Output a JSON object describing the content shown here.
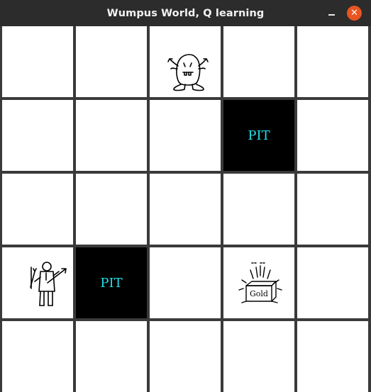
{
  "window": {
    "title": "Wumpus World, Q learning",
    "close_glyph": "✕"
  },
  "grid": {
    "rows": 5,
    "cols": 5,
    "cells": [
      [
        "empty",
        "empty",
        "wumpus",
        "empty",
        "empty"
      ],
      [
        "empty",
        "empty",
        "empty",
        "pit",
        "empty"
      ],
      [
        "empty",
        "empty",
        "empty",
        "empty",
        "empty"
      ],
      [
        "agent",
        "pit",
        "empty",
        "gold",
        "empty"
      ],
      [
        "empty",
        "empty",
        "empty",
        "empty",
        "empty"
      ]
    ]
  },
  "labels": {
    "pit": "PIT",
    "gold": "Gold"
  },
  "colors": {
    "pit_background": "#000000",
    "pit_text": "#22e0e8",
    "grid_line": "#3a3a3a",
    "cell_background": "#ffffff",
    "close_button": "#e95420"
  },
  "icons": {
    "wumpus": "wumpus-icon",
    "agent": "agent-icon",
    "gold": "gold-icon",
    "minimize": "minimize-icon",
    "close": "close-icon"
  }
}
